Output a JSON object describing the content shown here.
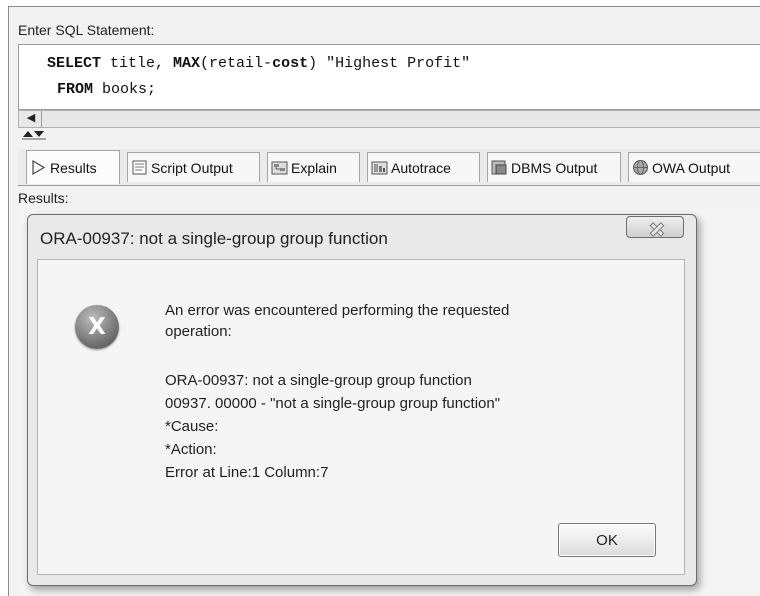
{
  "editor": {
    "label": "Enter SQL Statement:",
    "line1": {
      "keyword1": "SELECT",
      "text1": " title, ",
      "keyword2": "MAX",
      "text2": "(retail-",
      "keyword3": "cost",
      "text3": ") \"Highest Profit\""
    },
    "line2": {
      "keyword1": "FROM",
      "text1": " books;"
    }
  },
  "tabs": [
    {
      "label": "Results",
      "icon": "play-icon"
    },
    {
      "label": "Script Output",
      "icon": "script-output-icon"
    },
    {
      "label": "Explain",
      "icon": "explain-icon"
    },
    {
      "label": "Autotrace",
      "icon": "autotrace-icon"
    },
    {
      "label": "DBMS Output",
      "icon": "dbms-output-icon"
    },
    {
      "label": "OWA Output",
      "icon": "owa-output-icon"
    }
  ],
  "results": {
    "label": "Results:"
  },
  "dialog": {
    "title": "ORA-00937: not a single-group group function",
    "icon": "error-x-icon",
    "icon_letter": "X",
    "message_line1": "An error was encountered performing the requested",
    "message_line2": "operation:",
    "detail_lines": [
      "ORA-00937: not a single-group group function",
      "00937. 00000 -  \"not a single-group group function\"",
      "*Cause:",
      "*Action:",
      "Error at Line:1 Column:7"
    ],
    "ok_label": "OK"
  }
}
